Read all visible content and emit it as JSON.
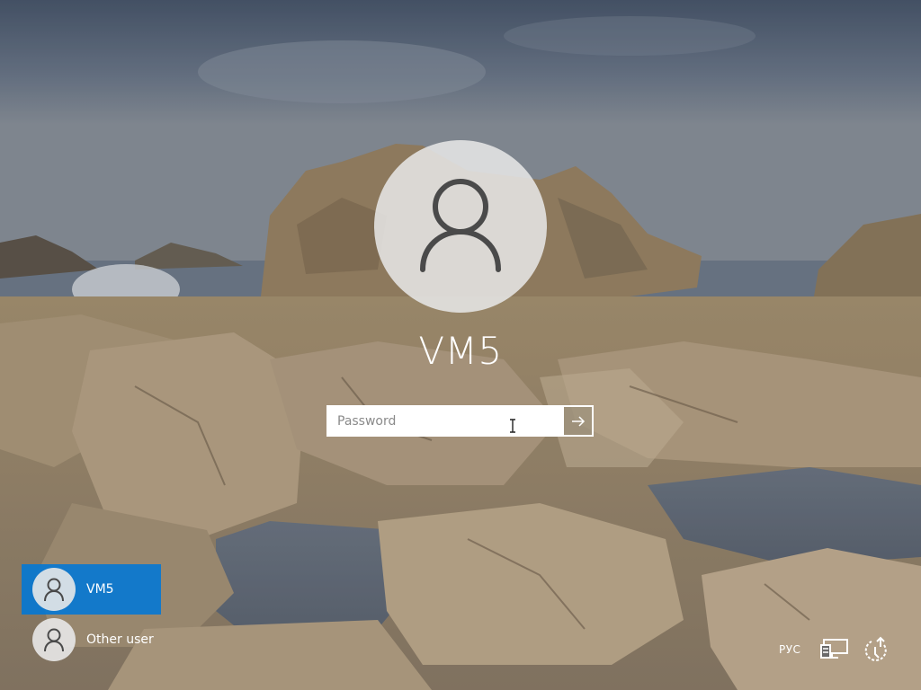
{
  "lock_screen": {
    "account_name": "VM5",
    "password": {
      "placeholder": "Password",
      "value": ""
    }
  },
  "user_list": {
    "users": [
      {
        "label": "VM5",
        "selected": true
      },
      {
        "label": "Other user",
        "selected": false
      }
    ]
  },
  "tray": {
    "language": "РУС",
    "icons": [
      "network-icon",
      "ease-of-access-icon"
    ]
  },
  "colors": {
    "selected_user_bg": "#0078d7",
    "text": "#ffffff"
  }
}
